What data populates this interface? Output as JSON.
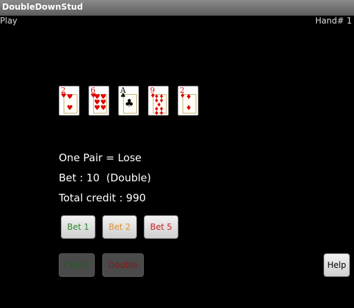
{
  "app": {
    "title": "DoubleDownStud"
  },
  "status": {
    "mode": "Play",
    "hand": "Hand# 1"
  },
  "cards": [
    {
      "rank": "2",
      "suit": "♥",
      "color": "red"
    },
    {
      "rank": "6",
      "suit": "♥",
      "color": "red"
    },
    {
      "rank": "A",
      "suit": "♣",
      "color": "black"
    },
    {
      "rank": "9",
      "suit": "♦",
      "color": "red"
    },
    {
      "rank": "2",
      "suit": "♦",
      "color": "red"
    }
  ],
  "result": {
    "hand_result": "One Pair = Lose",
    "bet": "Bet : 10  (Double)",
    "total_credit": "Total credit : 990"
  },
  "buttons": {
    "bet1": {
      "label": "Bet 1",
      "color": "#2a8a2a"
    },
    "bet2": {
      "label": "Bet 2",
      "color": "#e8912a"
    },
    "bet5": {
      "label": "Bet 5",
      "color": "#cc2222"
    },
    "check": {
      "label": "Check",
      "color": "#1e5e1e"
    },
    "double": {
      "label": "Double",
      "color": "#8a1515"
    },
    "help": {
      "label": "Help",
      "color": "#000000"
    }
  }
}
